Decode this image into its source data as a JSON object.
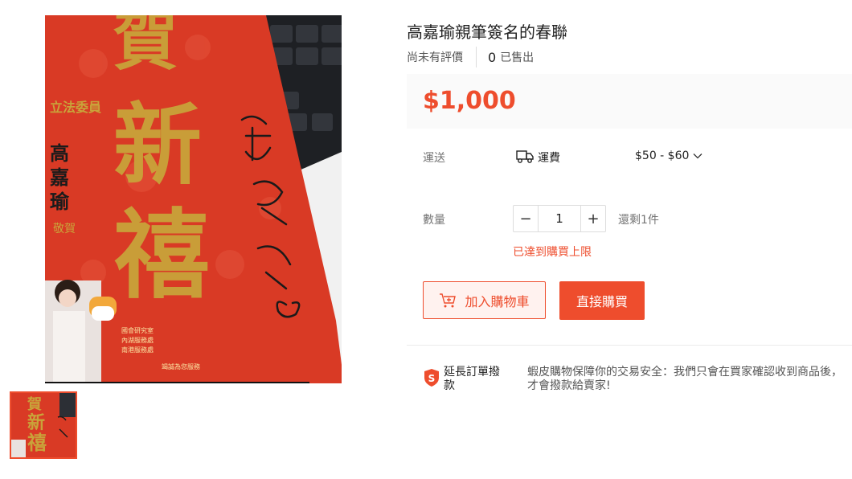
{
  "product": {
    "title": "高嘉瑜親筆簽名的春聯",
    "rating_text": "尚未有評價",
    "sold_count": "0",
    "sold_label": "已售出",
    "price": "$1,000"
  },
  "image": {
    "main_description": "red spring couplet poster with gold calligraphy and handwritten signature",
    "card_chars_top": "賀新禧",
    "card_side_label": "立法委員",
    "card_name": "高嘉瑜",
    "card_sub": "敬賀",
    "signature": "高嘉瑜",
    "card_footer": "竭誠為您服務"
  },
  "shipping": {
    "label": "運送",
    "fee_label": "運費",
    "fee_range": "$50 - $60",
    "icon": "truck-icon"
  },
  "quantity": {
    "label": "數量",
    "value": "1",
    "decrement": "−",
    "increment": "+",
    "stock_text": "還剩1件",
    "limit_message": "已達到購買上限"
  },
  "actions": {
    "add_to_cart": "加入購物車",
    "buy_now": "直接購買"
  },
  "guarantee": {
    "title": "延長訂單撥款",
    "text": "蝦皮購物保障你的交易安全：我們只會在買家確認收到商品後，才會撥款給賣家!"
  },
  "colors": {
    "accent": "#ee4d2d",
    "price_bg": "#fafafa"
  }
}
